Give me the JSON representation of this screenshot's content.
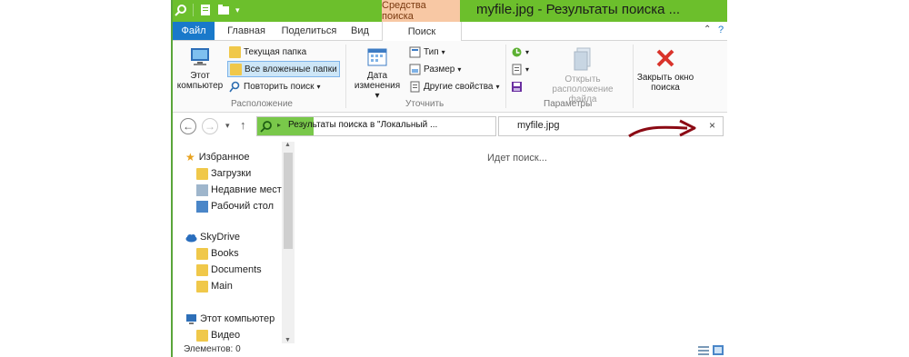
{
  "window": {
    "title": "myfile.jpg - Результаты поиска ...",
    "context_tab": "Средства поиска"
  },
  "tabs": [
    "Файл",
    "Главная",
    "Поделиться",
    "Вид",
    "Поиск"
  ],
  "active_tab": "Поиск",
  "ribbon": {
    "location": {
      "this_pc": "Этот компьютер",
      "current_folder": "Текущая папка",
      "all_subfolders": "Все вложенные папки",
      "search_again": "Повторить поиск",
      "label": "Расположение"
    },
    "refine": {
      "date_modified": "Дата изменения",
      "kind": "Тип",
      "size": "Размер",
      "other_properties": "Другие свойства",
      "label": "Уточнить"
    },
    "options": {
      "open_file_location": "Открыть расположение файла",
      "label": "Параметры"
    },
    "close": {
      "close_search": "Закрыть окно поиска"
    }
  },
  "address": {
    "path": "Результаты поиска в \"Локальный ..."
  },
  "search": {
    "value": "myfile.jpg"
  },
  "content": {
    "status_message": "Идет поиск..."
  },
  "navpane": {
    "favorites": "Избранное",
    "downloads": "Загрузки",
    "recent": "Недавние места",
    "desktop": "Рабочий стол",
    "skydrive": "SkyDrive",
    "books": "Books",
    "documents": "Documents",
    "main": "Main",
    "this_pc": "Этот компьютер",
    "video": "Видео"
  },
  "statusbar": {
    "items": "Элементов: 0"
  },
  "colors": {
    "titlebar": "#6cbf2c",
    "file_tab": "#1979ca",
    "context_tab": "#f8c8a4",
    "annotation_arrow": "#8b0a14"
  }
}
